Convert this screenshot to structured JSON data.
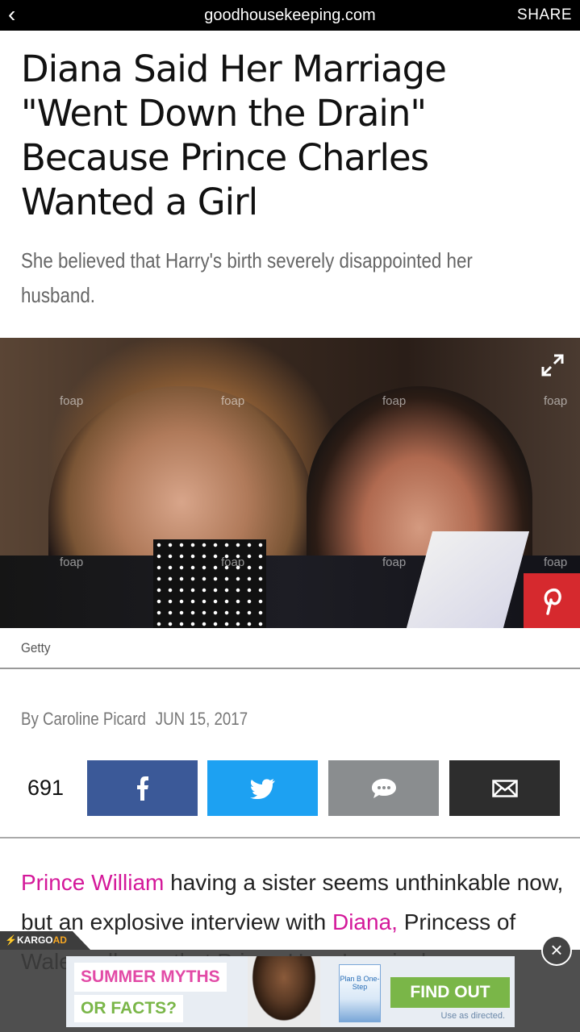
{
  "topbar": {
    "back": "‹",
    "domain": "goodhousekeeping.com",
    "share": "SHARE"
  },
  "article": {
    "headline": "Diana Said Her Marriage \"Went Down the Drain\" Because Prince Charles Wanted a Girl",
    "dek": "She believed that Harry's birth severely disappointed her husband.",
    "photo_credit": "Getty",
    "photo_watermark": "foap",
    "author": "By Caroline Picard",
    "date": "JUN 15, 2017"
  },
  "share_bar": {
    "count": "691",
    "colors": {
      "facebook": "#3b5998",
      "twitter": "#1da1f2",
      "comment": "#8a8d8f",
      "email": "#2d2d2d"
    }
  },
  "body": {
    "p1_link1": "Prince William",
    "p1_text1": " having a sister seems unthinkable now, but an explosive interview with ",
    "p1_link2": "Diana,",
    "p1_text2": " Princess of Wales, alleges that Prince Harry's arrival..."
  },
  "ad": {
    "tag_a": "KARGO",
    "tag_b": "AD",
    "close": "×",
    "line1": "SUMMER MYTHS",
    "line2": "OR FACTS?",
    "product": "Plan B One-Step",
    "cta": "FIND OUT",
    "fine": "Use as directed."
  }
}
